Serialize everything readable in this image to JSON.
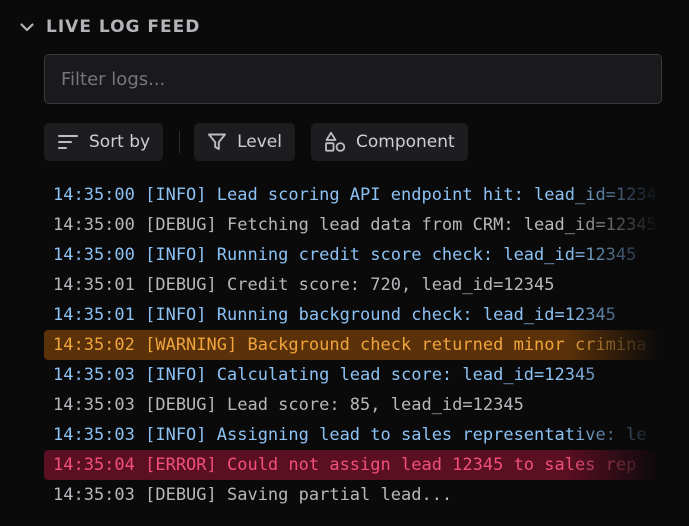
{
  "header": {
    "title": "LIVE LOG FEED",
    "collapse_icon": "chevron-down-icon"
  },
  "filter": {
    "placeholder": "Filter logs...",
    "value": ""
  },
  "toolbar": {
    "sort_label": "Sort by",
    "level_label": "Level",
    "component_label": "Component"
  },
  "icons": {
    "sort": "sort-icon",
    "level": "funnel-icon",
    "component": "shapes-icon"
  },
  "colors": {
    "info": "#8cc2f4",
    "debug": "#b8b8bc",
    "warning_text": "#f0a43c",
    "warning_bg": "#5a3109",
    "error_text": "#f2507a",
    "error_bg": "#5a0f23"
  },
  "logs": [
    {
      "level": "INFO",
      "text": "14:35:00 [INFO] Lead scoring API endpoint hit: lead_id=12345"
    },
    {
      "level": "DEBUG",
      "text": "14:35:00 [DEBUG] Fetching lead data from CRM: lead_id=12345"
    },
    {
      "level": "INFO",
      "text": "14:35:00 [INFO] Running credit score check: lead_id=12345"
    },
    {
      "level": "DEBUG",
      "text": "14:35:01 [DEBUG] Credit score: 720, lead_id=12345"
    },
    {
      "level": "INFO",
      "text": "14:35:01 [INFO] Running background check: lead_id=12345"
    },
    {
      "level": "WARNING",
      "text": "14:35:02 [WARNING] Background check returned minor crimina"
    },
    {
      "level": "INFO",
      "text": "14:35:03 [INFO] Calculating lead score: lead_id=12345"
    },
    {
      "level": "DEBUG",
      "text": "14:35:03 [DEBUG] Lead score: 85, lead_id=12345"
    },
    {
      "level": "INFO",
      "text": "14:35:03 [INFO] Assigning lead to sales representative: le"
    },
    {
      "level": "ERROR",
      "text": "14:35:04 [ERROR] Could not assign lead 12345 to sales rep"
    },
    {
      "level": "DEBUG",
      "text": "14:35:03 [DEBUG] Saving partial lead..."
    }
  ]
}
